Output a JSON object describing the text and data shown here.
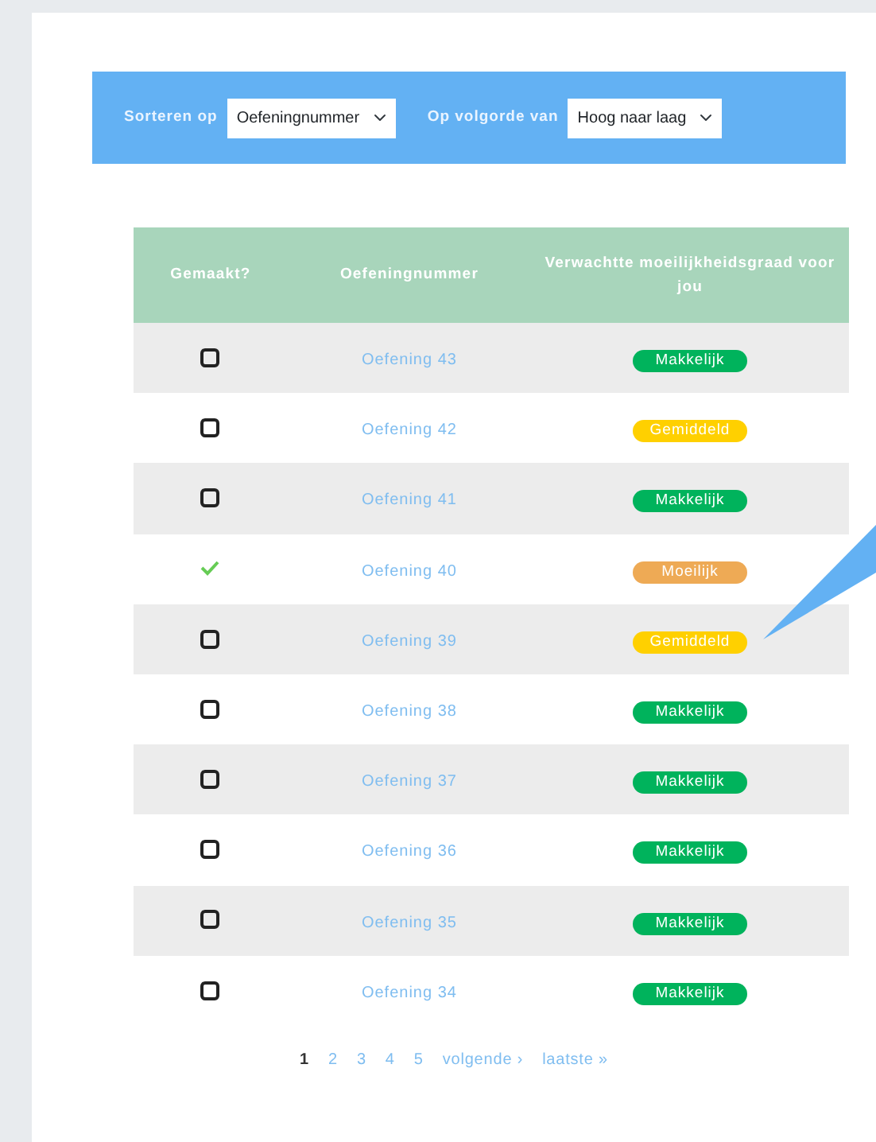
{
  "sort_bar": {
    "sort_label": "Sorteren op",
    "sort_value": "Oefeningnummer",
    "order_label": "Op volgorde van",
    "order_value": "Hoog naar laag"
  },
  "table": {
    "columns": [
      "Gemaakt?",
      "Oefeningnummer",
      "Verwachtte moeilijkheidsgraad voor jou"
    ],
    "rows": [
      {
        "checked": false,
        "exercise": "Oefening 43",
        "difficulty": "Makkelijk",
        "color": "#00b35c"
      },
      {
        "checked": false,
        "exercise": "Oefening 42",
        "difficulty": "Gemiddeld",
        "color": "#ffd000"
      },
      {
        "checked": false,
        "exercise": "Oefening 41",
        "difficulty": "Makkelijk",
        "color": "#00b35c"
      },
      {
        "checked": true,
        "exercise": "Oefening 40",
        "difficulty": "Moeilijk",
        "color": "#eeaa55"
      },
      {
        "checked": false,
        "exercise": "Oefening 39",
        "difficulty": "Gemiddeld",
        "color": "#ffd000"
      },
      {
        "checked": false,
        "exercise": "Oefening 38",
        "difficulty": "Makkelijk",
        "color": "#00b35c"
      },
      {
        "checked": false,
        "exercise": "Oefening 37",
        "difficulty": "Makkelijk",
        "color": "#00b35c"
      },
      {
        "checked": false,
        "exercise": "Oefening 36",
        "difficulty": "Makkelijk",
        "color": "#00b35c"
      },
      {
        "checked": false,
        "exercise": "Oefening 35",
        "difficulty": "Makkelijk",
        "color": "#00b35c"
      },
      {
        "checked": false,
        "exercise": "Oefening 34",
        "difficulty": "Makkelijk",
        "color": "#00b35c"
      }
    ]
  },
  "pagination": [
    {
      "label": "1",
      "selected": true
    },
    {
      "label": "2",
      "selected": false
    },
    {
      "label": "3",
      "selected": false
    },
    {
      "label": "4",
      "selected": false
    },
    {
      "label": "5",
      "selected": false
    },
    {
      "label": "volgende ›",
      "selected": false
    },
    {
      "label": "laatste »",
      "selected": false
    }
  ]
}
